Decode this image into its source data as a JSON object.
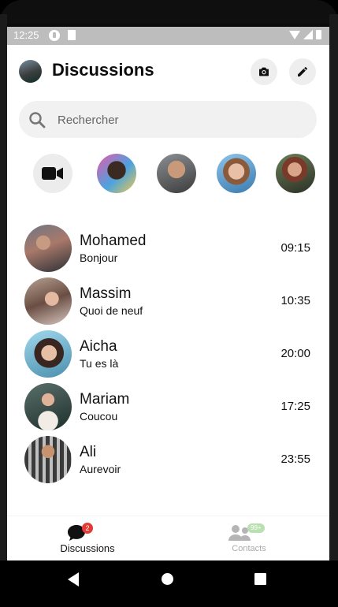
{
  "status_bar": {
    "time": "12:25"
  },
  "header": {
    "title": "Discussions"
  },
  "search": {
    "placeholder": "Rechercher"
  },
  "colors": {
    "badge_red": "#e53935",
    "badge_green": "#b8e0b0",
    "search_bg": "#f1f1f1"
  },
  "conversations": [
    {
      "name": "Mohamed",
      "message": "Bonjour",
      "time": "09:15"
    },
    {
      "name": "Massim",
      "message": "Quoi de neuf",
      "time": "10:35"
    },
    {
      "name": "Aicha",
      "message": "Tu es là",
      "time": "20:00"
    },
    {
      "name": "Mariam",
      "message": "Coucou",
      "time": "17:25"
    },
    {
      "name": "Ali",
      "message": "Aurevoir",
      "time": "23:55"
    }
  ],
  "bottom_nav": {
    "discussions": {
      "label": "Discussions",
      "badge": "2"
    },
    "contacts": {
      "label": "Contacts",
      "badge": "99+"
    }
  }
}
